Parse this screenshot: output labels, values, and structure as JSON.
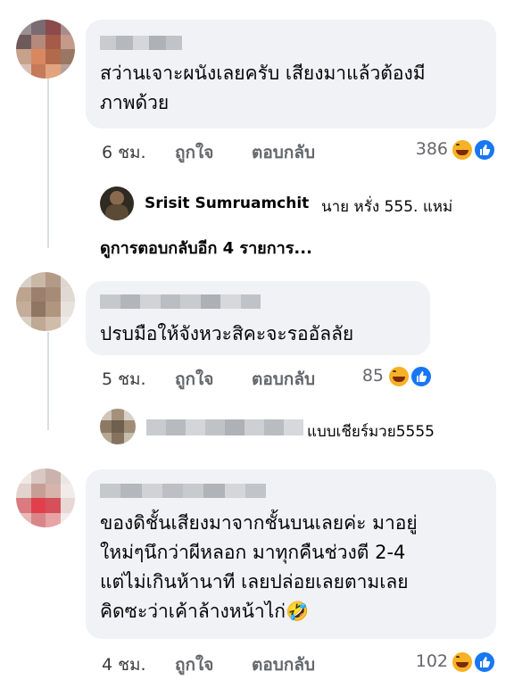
{
  "comments": [
    {
      "text": "สว่านเจาะผนังเลยครับ เสียงมาแล้วต้องมี\nภาพด้วย",
      "time": "6 ชม.",
      "like_label": "ถูกใจ",
      "reply_label": "ตอบกลับ",
      "reaction_count": "386",
      "reactions": [
        "haha-icon",
        "like-icon"
      ],
      "reply_preview": {
        "author": "Srisit Sumruamchit",
        "text": "นาย หรั่ง 555. แหม่"
      },
      "view_more": "ดูการตอบกลับอีก 4 รายการ..."
    },
    {
      "text": "ปรบมือให้จังหวะสิคะจะรออัลลัย",
      "time": "5 ชม.",
      "like_label": "ถูกใจ",
      "reply_label": "ตอบกลับ",
      "reaction_count": "85",
      "reactions": [
        "haha-icon",
        "like-icon"
      ],
      "reply_preview": {
        "text": "แบบเชียร์มวย5555"
      }
    },
    {
      "text": "ของดิชั้นเสียงมาจากชั้นบนเลยค่ะ มาอยู่\nใหม่ๆนึกว่าผีหลอก มาทุกคืนช่วงตี 2-4\nแต่ไม่เกินห้านาที เลยปล่อยเลยตามเลย\nคิดซะว่าเค้าล้างหน้าไก่🤣",
      "time": "4 ชม.",
      "like_label": "ถูกใจ",
      "reply_label": "ตอบกลับ",
      "reaction_count": "102",
      "reactions": [
        "haha-icon",
        "like-icon"
      ]
    }
  ],
  "colors": {
    "bubble": "#f0f2f5",
    "meta": "#65676b",
    "like_blue": "#1877f2",
    "haha_yellow": "#f7b125"
  }
}
